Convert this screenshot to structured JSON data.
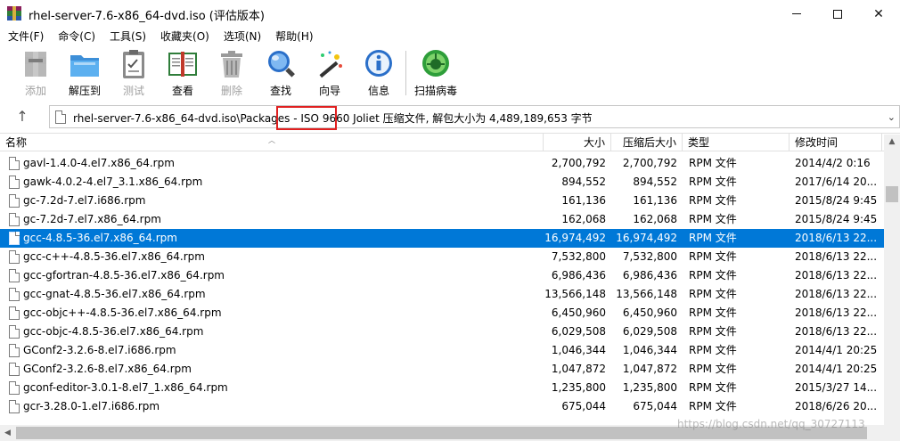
{
  "window": {
    "title": "rhel-server-7.6-x86_64-dvd.iso (评估版本)"
  },
  "menu": [
    "文件(F)",
    "命令(C)",
    "工具(S)",
    "收藏夹(O)",
    "选项(N)",
    "帮助(H)"
  ],
  "toolbar": {
    "add": "添加",
    "extract": "解压到",
    "test": "测试",
    "view": "查看",
    "delete": "删除",
    "find": "查找",
    "wizard": "向导",
    "info": "信息",
    "scan": "扫描病毒"
  },
  "address": {
    "path_prefix": "rhel-server-7.6-x86_64-dvd.iso\\",
    "path_highlight": "Packages",
    "path_suffix": " - ISO 9660 Joliet 压缩文件, 解包大小为 4,489,189,653 字节"
  },
  "columns": {
    "name": "名称",
    "size": "大小",
    "packed": "压缩后大小",
    "type": "类型",
    "modified": "修改时间"
  },
  "files": [
    {
      "name": "gavl-1.4.0-4.el7.x86_64.rpm",
      "size": "2,700,792",
      "packed": "2,700,792",
      "type": "RPM 文件",
      "modified": "2014/4/2 0:16"
    },
    {
      "name": "gawk-4.0.2-4.el7_3.1.x86_64.rpm",
      "size": "894,552",
      "packed": "894,552",
      "type": "RPM 文件",
      "modified": "2017/6/14 20..."
    },
    {
      "name": "gc-7.2d-7.el7.i686.rpm",
      "size": "161,136",
      "packed": "161,136",
      "type": "RPM 文件",
      "modified": "2015/8/24 9:45"
    },
    {
      "name": "gc-7.2d-7.el7.x86_64.rpm",
      "size": "162,068",
      "packed": "162,068",
      "type": "RPM 文件",
      "modified": "2015/8/24 9:45"
    },
    {
      "name": "gcc-4.8.5-36.el7.x86_64.rpm",
      "size": "16,974,492",
      "packed": "16,974,492",
      "type": "RPM 文件",
      "modified": "2018/6/13 22..."
    },
    {
      "name": "gcc-c++-4.8.5-36.el7.x86_64.rpm",
      "size": "7,532,800",
      "packed": "7,532,800",
      "type": "RPM 文件",
      "modified": "2018/6/13 22..."
    },
    {
      "name": "gcc-gfortran-4.8.5-36.el7.x86_64.rpm",
      "size": "6,986,436",
      "packed": "6,986,436",
      "type": "RPM 文件",
      "modified": "2018/6/13 22..."
    },
    {
      "name": "gcc-gnat-4.8.5-36.el7.x86_64.rpm",
      "size": "13,566,148",
      "packed": "13,566,148",
      "type": "RPM 文件",
      "modified": "2018/6/13 22..."
    },
    {
      "name": "gcc-objc++-4.8.5-36.el7.x86_64.rpm",
      "size": "6,450,960",
      "packed": "6,450,960",
      "type": "RPM 文件",
      "modified": "2018/6/13 22..."
    },
    {
      "name": "gcc-objc-4.8.5-36.el7.x86_64.rpm",
      "size": "6,029,508",
      "packed": "6,029,508",
      "type": "RPM 文件",
      "modified": "2018/6/13 22..."
    },
    {
      "name": "GConf2-3.2.6-8.el7.i686.rpm",
      "size": "1,046,344",
      "packed": "1,046,344",
      "type": "RPM 文件",
      "modified": "2014/4/1 20:25"
    },
    {
      "name": "GConf2-3.2.6-8.el7.x86_64.rpm",
      "size": "1,047,872",
      "packed": "1,047,872",
      "type": "RPM 文件",
      "modified": "2014/4/1 20:25"
    },
    {
      "name": "gconf-editor-3.0.1-8.el7_1.x86_64.rpm",
      "size": "1,235,800",
      "packed": "1,235,800",
      "type": "RPM 文件",
      "modified": "2015/3/27 14..."
    },
    {
      "name": "gcr-3.28.0-1.el7.i686.rpm",
      "size": "675,044",
      "packed": "675,044",
      "type": "RPM 文件",
      "modified": "2018/6/26 20..."
    }
  ],
  "selected_index": 4,
  "watermark": "https://blog.csdn.net/qq_30727113",
  "colors": {
    "selection": "#0078d7",
    "highlight_box": "#e02020"
  }
}
